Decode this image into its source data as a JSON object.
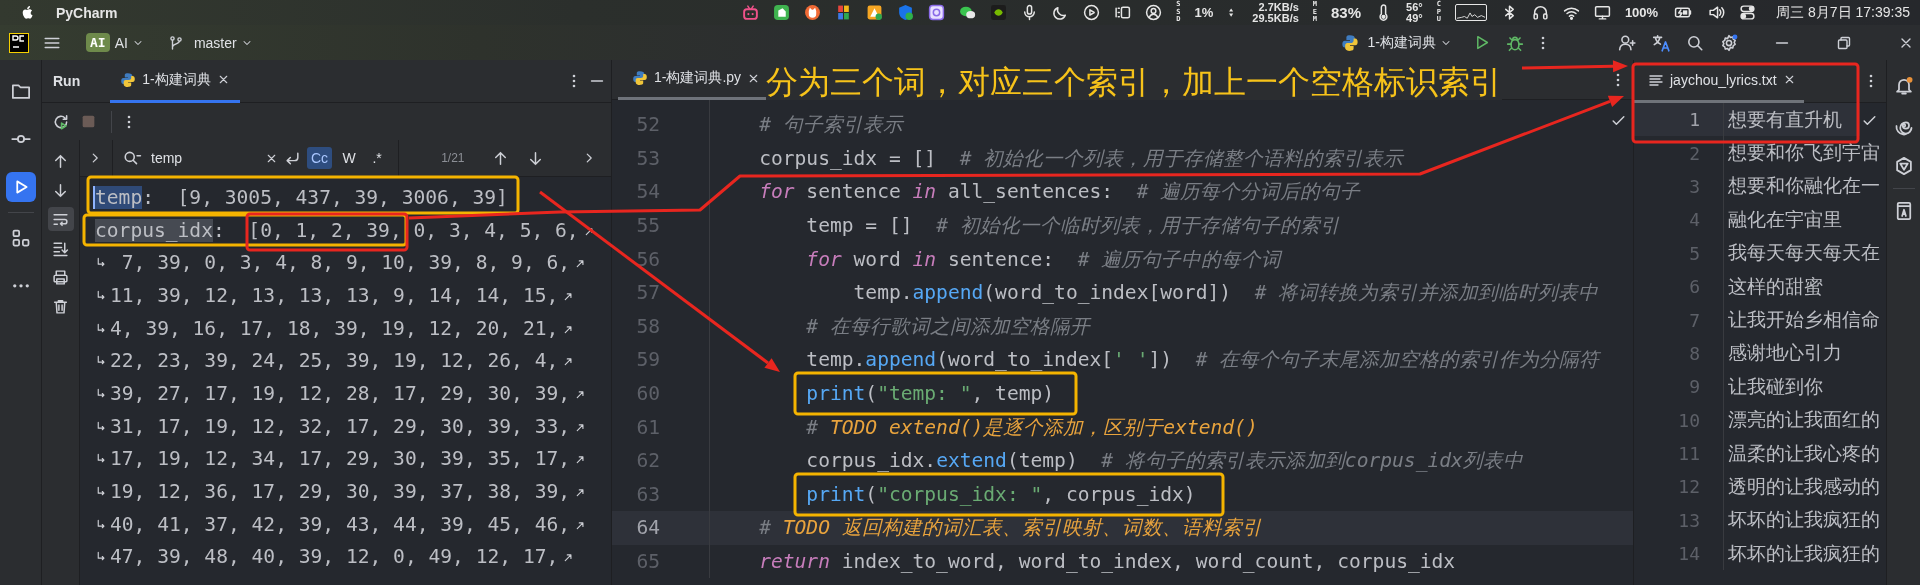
{
  "menu_bar": {
    "app_name": "PyCharm",
    "ssd_label": "SSD",
    "ssd_usage": "1%",
    "upload_rate": "2.7KB/s",
    "download_rate": "29.5KB/s",
    "mem_label": "MEM",
    "mem_usage": "83%",
    "temp_high": "56°",
    "temp_low": "49°",
    "cpu_label": "CPU",
    "battery": "100%",
    "clock": "周三 8月7日 17:39:35"
  },
  "toolbar": {
    "ai_badge": "AI",
    "ai_label": "AI",
    "branch": "master",
    "run_config": "1-构建词典"
  },
  "tool_strip": [
    {
      "kind": "folder",
      "selected": false
    },
    {
      "kind": "commit",
      "selected": false
    },
    {
      "kind": "run",
      "selected": true
    },
    {
      "kind": "structure",
      "selected": false
    },
    {
      "kind": "more",
      "selected": false
    }
  ],
  "run_panel": {
    "title": "Run",
    "tabs": [
      {
        "label": "1-构建词典",
        "selected": true
      }
    ],
    "side_tools": [
      {
        "kind": "up",
        "selected": false
      },
      {
        "kind": "down",
        "selected": false
      },
      {
        "kind": "wrap",
        "selected": true
      },
      {
        "kind": "scroll_end",
        "selected": false
      },
      {
        "kind": "print",
        "selected": false
      },
      {
        "kind": "trash",
        "selected": false
      }
    ],
    "search": {
      "value": "temp",
      "options": [
        {
          "label": "Cc",
          "selected": true
        },
        {
          "label": "W",
          "selected": false
        },
        {
          "label": ".*",
          "selected": false
        }
      ],
      "match_count": "1/21"
    },
    "output": [
      {
        "match": "temp",
        "current_match": true,
        "text": ":  [9, 3005, 437, 39, 3006, 39]",
        "continued": false,
        "wrapped": false
      },
      {
        "match": "corpus_idx",
        "current_match": false,
        "text": ":  [0, 1, 2, 39, 0, 3, 4, 5, 6,",
        "continued": false,
        "wrapped": true
      },
      {
        "text": " 7, 39, 0, 3, 4, 8, 9, 10, 39, 8, 9, 6,",
        "continued": true,
        "wrapped": true
      },
      {
        "text": "11, 39, 12, 13, 13, 13, 9, 14, 14, 15,",
        "continued": true,
        "wrapped": true
      },
      {
        "text": "4, 39, 16, 17, 18, 39, 19, 12, 20, 21,",
        "continued": true,
        "wrapped": true
      },
      {
        "text": "22, 23, 39, 24, 25, 39, 19, 12, 26, 4,",
        "continued": true,
        "wrapped": true
      },
      {
        "text": "39, 27, 17, 19, 12, 28, 17, 29, 30, 39,",
        "continued": true,
        "wrapped": true
      },
      {
        "text": "31, 17, 19, 12, 32, 17, 29, 30, 39, 33,",
        "continued": true,
        "wrapped": true
      },
      {
        "text": "17, 19, 12, 34, 17, 29, 30, 39, 35, 17,",
        "continued": true,
        "wrapped": true
      },
      {
        "text": "19, 12, 36, 17, 29, 30, 39, 37, 38, 39,",
        "continued": true,
        "wrapped": true
      },
      {
        "text": "40, 41, 37, 42, 39, 43, 44, 39, 45, 46,",
        "continued": true,
        "wrapped": true
      },
      {
        "text": "47, 39, 48, 40, 39, 12, 0, 49, 12, 17,",
        "continued": true,
        "wrapped": true
      }
    ]
  },
  "editor": {
    "tabs": [
      {
        "label": "1-构建词典.py",
        "selected": true
      }
    ],
    "lines": [
      {
        "number": "52",
        "current": false,
        "tokens": [
          {
            "kind": "comment",
            "text": "    # 句子索引表示"
          }
        ]
      },
      {
        "number": "53",
        "current": false,
        "tokens": [
          {
            "kind": "plain",
            "text": "    corpus_idx = []  "
          },
          {
            "kind": "comment",
            "text": "# 初始化一个列表，用于存储整个语料的索引表示"
          }
        ]
      },
      {
        "number": "54",
        "current": false,
        "tokens": [
          {
            "kind": "keyword",
            "text": "    for"
          },
          {
            "kind": "plain",
            "text": " sentence "
          },
          {
            "kind": "keyword",
            "text": "in"
          },
          {
            "kind": "plain",
            "text": " all_sentences:  "
          },
          {
            "kind": "comment",
            "text": "# 遍历每个分词后的句子"
          }
        ]
      },
      {
        "number": "55",
        "current": false,
        "tokens": [
          {
            "kind": "plain",
            "text": "        temp = []  "
          },
          {
            "kind": "comment",
            "text": "# 初始化一个临时列表，用于存储句子的索引"
          }
        ]
      },
      {
        "number": "56",
        "current": false,
        "tokens": [
          {
            "kind": "keyword",
            "text": "        for"
          },
          {
            "kind": "plain",
            "text": " word "
          },
          {
            "kind": "keyword",
            "text": "in"
          },
          {
            "kind": "plain",
            "text": " sentence:  "
          },
          {
            "kind": "comment",
            "text": "# 遍历句子中的每个词"
          }
        ]
      },
      {
        "number": "57",
        "current": false,
        "tokens": [
          {
            "kind": "plain",
            "text": "            temp."
          },
          {
            "kind": "call",
            "text": "append"
          },
          {
            "kind": "plain",
            "text": "(word_to_index[word])  "
          },
          {
            "kind": "comment",
            "text": "# 将词转换为索引并添加到临时列表中"
          }
        ]
      },
      {
        "number": "58",
        "current": false,
        "tokens": [
          {
            "kind": "comment",
            "text": "        # 在每行歌词之间添加空格隔开"
          }
        ]
      },
      {
        "number": "59",
        "current": false,
        "tokens": [
          {
            "kind": "plain",
            "text": "        temp."
          },
          {
            "kind": "call",
            "text": "append"
          },
          {
            "kind": "plain",
            "text": "(word_to_index["
          },
          {
            "kind": "string",
            "text": "' '"
          },
          {
            "kind": "plain",
            "text": "])  "
          },
          {
            "kind": "comment",
            "text": "# 在每个句子末尾添加空格的索引作为分隔符"
          }
        ]
      },
      {
        "number": "60",
        "current": false,
        "tokens": [
          {
            "kind": "call",
            "text": "        print"
          },
          {
            "kind": "plain",
            "text": "("
          },
          {
            "kind": "string",
            "text": "\"temp: \""
          },
          {
            "kind": "plain",
            "text": ", temp)"
          }
        ]
      },
      {
        "number": "61",
        "current": false,
        "tokens": [
          {
            "kind": "comment",
            "text": "        # "
          },
          {
            "kind": "todo",
            "text": "TODO extend()是逐个添加，区别于extend()"
          }
        ]
      },
      {
        "number": "62",
        "current": false,
        "tokens": [
          {
            "kind": "plain",
            "text": "        corpus_idx."
          },
          {
            "kind": "call",
            "text": "extend"
          },
          {
            "kind": "plain",
            "text": "(temp)  "
          },
          {
            "kind": "comment",
            "text": "# 将句子的索引表示添加到corpus_idx列表中"
          }
        ]
      },
      {
        "number": "63",
        "current": false,
        "tokens": [
          {
            "kind": "call",
            "text": "        print"
          },
          {
            "kind": "plain",
            "text": "("
          },
          {
            "kind": "string",
            "text": "\"corpus_idx: \""
          },
          {
            "kind": "plain",
            "text": ", corpus_idx)"
          }
        ]
      },
      {
        "number": "64",
        "current": true,
        "tokens": [
          {
            "kind": "comment",
            "text": "    # "
          },
          {
            "kind": "todo",
            "text": "TODO 返回构建的词汇表、索引映射、词数、语料索引"
          }
        ]
      },
      {
        "number": "65",
        "current": false,
        "tokens": [
          {
            "kind": "keyword",
            "text": "    return"
          },
          {
            "kind": "plain",
            "text": " index_to_word, word_to_index, word_count, corpus_idx"
          }
        ]
      }
    ]
  },
  "lyrics": {
    "tabs": [
      {
        "label": "jaychou_lyrics.txt",
        "selected": true
      }
    ],
    "lines": [
      {
        "number": "1",
        "current": true,
        "text": "想要有直升机"
      },
      {
        "number": "2",
        "current": false,
        "text": "想要和你飞到宇宙"
      },
      {
        "number": "3",
        "current": false,
        "text": "想要和你融化在一"
      },
      {
        "number": "4",
        "current": false,
        "text": "融化在宇宙里"
      },
      {
        "number": "5",
        "current": false,
        "text": "我每天每天每天在"
      },
      {
        "number": "6",
        "current": false,
        "text": "这样的甜蜜"
      },
      {
        "number": "7",
        "current": false,
        "text": "让我开始乡相信命"
      },
      {
        "number": "8",
        "current": false,
        "text": "感谢地心引力"
      },
      {
        "number": "9",
        "current": false,
        "text": "让我碰到你"
      },
      {
        "number": "10",
        "current": false,
        "text": "漂亮的让我面红的"
      },
      {
        "number": "11",
        "current": false,
        "text": "温柔的让我心疼的"
      },
      {
        "number": "12",
        "current": false,
        "text": "透明的让我感动的"
      },
      {
        "number": "13",
        "current": false,
        "text": "坏坏的让我疯狂的"
      },
      {
        "number": "14",
        "current": false,
        "text": "坏坏的让我疯狂的"
      }
    ]
  },
  "annotation": {
    "banner": "分为三个词，对应三个索引，加上一个空格标识索引"
  }
}
